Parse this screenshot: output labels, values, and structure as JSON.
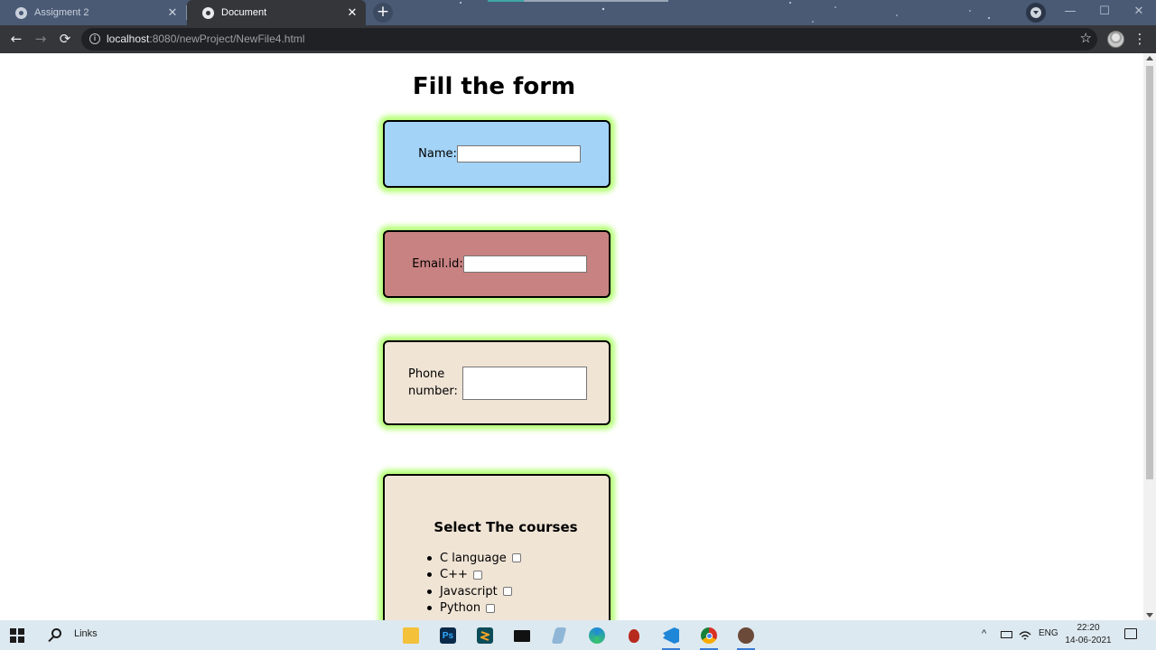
{
  "browser": {
    "tabs": [
      {
        "title": "Assigment 2",
        "active": false
      },
      {
        "title": "Document",
        "active": true
      }
    ],
    "url_host": "localhost",
    "url_path": ":8080/newProject/NewFile4.html",
    "new_tab_symbol": "+",
    "close_symbol": "✕",
    "star_symbol": "☆",
    "menu_symbol": "⋮",
    "back_symbol": "←",
    "forward_symbol": "→",
    "reload_symbol": "⟳",
    "info_symbol": "i",
    "window_controls": {
      "minimize": "—",
      "maximize": "☐",
      "close": "✕"
    }
  },
  "page": {
    "heading": "Fill the form",
    "name_label": "Name:",
    "email_label": "Email.id:",
    "phone_label": "Phone number:",
    "courses_heading": "Select The courses",
    "courses": [
      "C language",
      "C++",
      "Javascript",
      "Python"
    ],
    "colors": {
      "name_card": "#a3d3f7",
      "email_card": "#c98282",
      "phone_card": "#f0e4d5",
      "courses_card": "#f0e4d5",
      "glow": "#b7ff7a"
    }
  },
  "taskbar": {
    "search_label": "Links",
    "language": "ENG",
    "time": "22:20",
    "date": "14-06-2021",
    "apps": [
      "file-explorer",
      "photoshop",
      "sublime-text",
      "terminal",
      "notepad",
      "edge",
      "bug-app",
      "vscode",
      "chrome",
      "app-icon"
    ]
  }
}
